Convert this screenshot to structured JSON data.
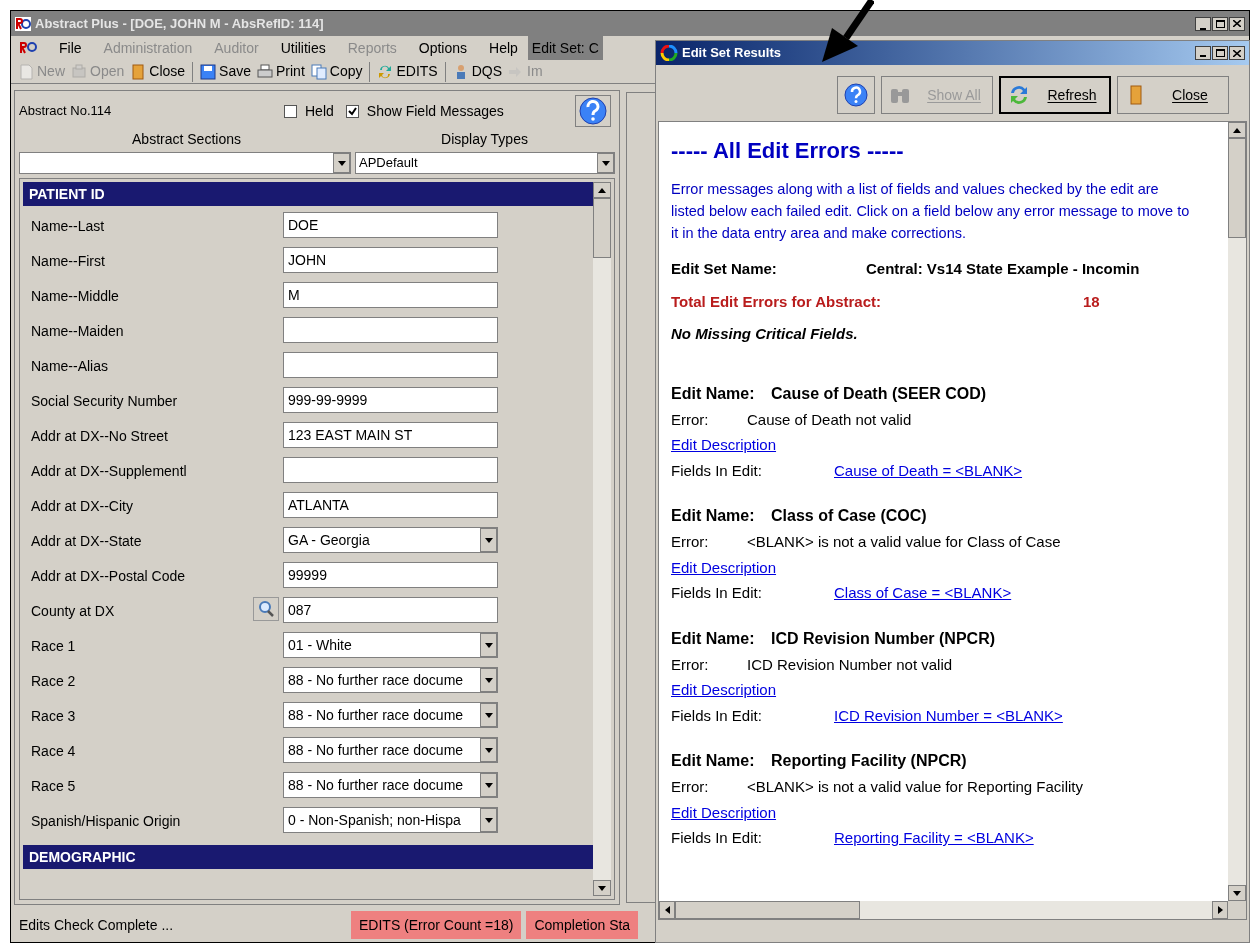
{
  "window": {
    "title": "Abstract Plus - [DOE, JOHN M - AbsRefID: 114]"
  },
  "menu": [
    {
      "label": "File",
      "disabled": false
    },
    {
      "label": "Administration",
      "disabled": true
    },
    {
      "label": "Auditor",
      "disabled": true
    },
    {
      "label": "Utilities",
      "disabled": false
    },
    {
      "label": "Reports",
      "disabled": true
    },
    {
      "label": "Options",
      "disabled": false
    },
    {
      "label": "Help",
      "disabled": false
    }
  ],
  "edit_set_indicator": "Edit Set: C",
  "toolbar": [
    {
      "kind": "new",
      "label": "New",
      "disabled": true
    },
    {
      "kind": "open",
      "label": "Open",
      "disabled": true
    },
    {
      "kind": "close",
      "label": "Close",
      "disabled": false
    },
    {
      "kind": "save",
      "label": "Save",
      "disabled": false
    },
    {
      "kind": "print",
      "label": "Print",
      "disabled": false
    },
    {
      "kind": "copy",
      "label": "Copy",
      "disabled": false
    },
    {
      "kind": "edits",
      "label": "EDITS",
      "disabled": false
    },
    {
      "kind": "dqs",
      "label": "DQS",
      "disabled": false
    },
    {
      "kind": "import",
      "label": "Im",
      "disabled": true
    }
  ],
  "abstract": {
    "number": "Abstract No.114",
    "held": {
      "label": "Held",
      "checked": false
    },
    "show_field_messages": {
      "label": "Show Field Messages",
      "checked": true
    },
    "sections_label": "Abstract Sections",
    "display_types_label": "Display Types",
    "display_type": "APDefault"
  },
  "sections": [
    {
      "title": "PATIENT ID",
      "fields": [
        {
          "label": "Name--Last",
          "kind": "text",
          "value": "DOE"
        },
        {
          "label": "Name--First",
          "kind": "text",
          "value": "JOHN"
        },
        {
          "label": "Name--Middle",
          "kind": "text",
          "value": "M"
        },
        {
          "label": "Name--Maiden",
          "kind": "text"
        },
        {
          "label": "Name--Alias",
          "kind": "text"
        },
        {
          "label": "Social Security Number",
          "kind": "text",
          "value": "999-99-9999"
        },
        {
          "label": "Addr at DX--No Street",
          "kind": "text",
          "value": "123 EAST MAIN ST"
        },
        {
          "label": "Addr at DX--Supplementl",
          "kind": "text"
        },
        {
          "label": "Addr at DX--City",
          "kind": "text",
          "value": "ATLANTA"
        },
        {
          "label": "Addr at DX--State",
          "kind": "select",
          "value": "GA - Georgia"
        },
        {
          "label": "Addr at DX--Postal Code",
          "kind": "text",
          "value": "99999"
        },
        {
          "label": "County at DX",
          "kind": "lookup",
          "value": "087"
        },
        {
          "label": "Race 1",
          "kind": "select",
          "value": "01 - White"
        },
        {
          "label": "Race 2",
          "kind": "select",
          "value": "88 - No further race docume"
        },
        {
          "label": "Race 3",
          "kind": "select",
          "value": "88 - No further race docume"
        },
        {
          "label": "Race 4",
          "kind": "select",
          "value": "88 - No further race docume"
        },
        {
          "label": "Race 5",
          "kind": "select",
          "value": "88 - No further race docume"
        },
        {
          "label": "Spanish/Hispanic Origin",
          "kind": "select",
          "value": "0 - Non-Spanish; non-Hispa"
        }
      ]
    },
    {
      "title": "DEMOGRAPHIC"
    }
  ],
  "status_bar": {
    "message": "Edits Check Complete ...",
    "edits": "EDITS (Error Count =18)",
    "completion": "Completion Sta"
  },
  "dialog": {
    "title": "Edit Set Results",
    "buttons": [
      {
        "kind": "help"
      },
      {
        "kind": "show_all",
        "label": "Show All",
        "disabled": true
      },
      {
        "kind": "refresh",
        "label": "Refresh",
        "disabled": false
      },
      {
        "kind": "close",
        "label": "Close",
        "disabled": false
      }
    ],
    "heading": "----- All Edit Errors -----",
    "intro": "Error messages along with a list of fields and values checked by the edit are listed below each failed edit.  Click on a field below any error message to move to it in the data entry area and make corrections.",
    "edit_set_name_label": "Edit Set Name:",
    "edit_set_name": "Central: Vs14 State Example - Incomin",
    "total_label": "Total Edit Errors for Abstract:",
    "total": "18",
    "critical": "No Missing Critical Fields.",
    "edits": [
      {
        "name_label": "Edit Name:",
        "name": "Cause of Death (SEER COD)",
        "error_label": "Error:",
        "error": "Cause of Death not valid",
        "description_link": "Edit Description",
        "fields_label": "Fields In Edit:",
        "field_link": "Cause of Death = <BLANK>"
      },
      {
        "name_label": "Edit Name:",
        "name": "Class of Case (COC)",
        "error_label": "Error:",
        "error": "<BLANK> is not a valid value for Class of Case",
        "description_link": "Edit Description",
        "fields_label": "Fields In Edit:",
        "field_link": "Class of Case = <BLANK>"
      },
      {
        "name_label": "Edit Name:",
        "name": "ICD Revision Number (NPCR)",
        "error_label": "Error:",
        "error": "ICD Revision Number not valid",
        "description_link": "Edit Description",
        "fields_label": "Fields In Edit:",
        "field_link": "ICD Revision Number = <BLANK>"
      },
      {
        "name_label": "Edit Name:",
        "name": "Reporting Facility (NPCR)",
        "error_label": "Error:",
        "error": "<BLANK> is not a valid value for Reporting Facility",
        "description_link": "Edit Description",
        "fields_label": "Fields In Edit:",
        "field_link": "Reporting Facility = <BLANK>"
      }
    ]
  }
}
